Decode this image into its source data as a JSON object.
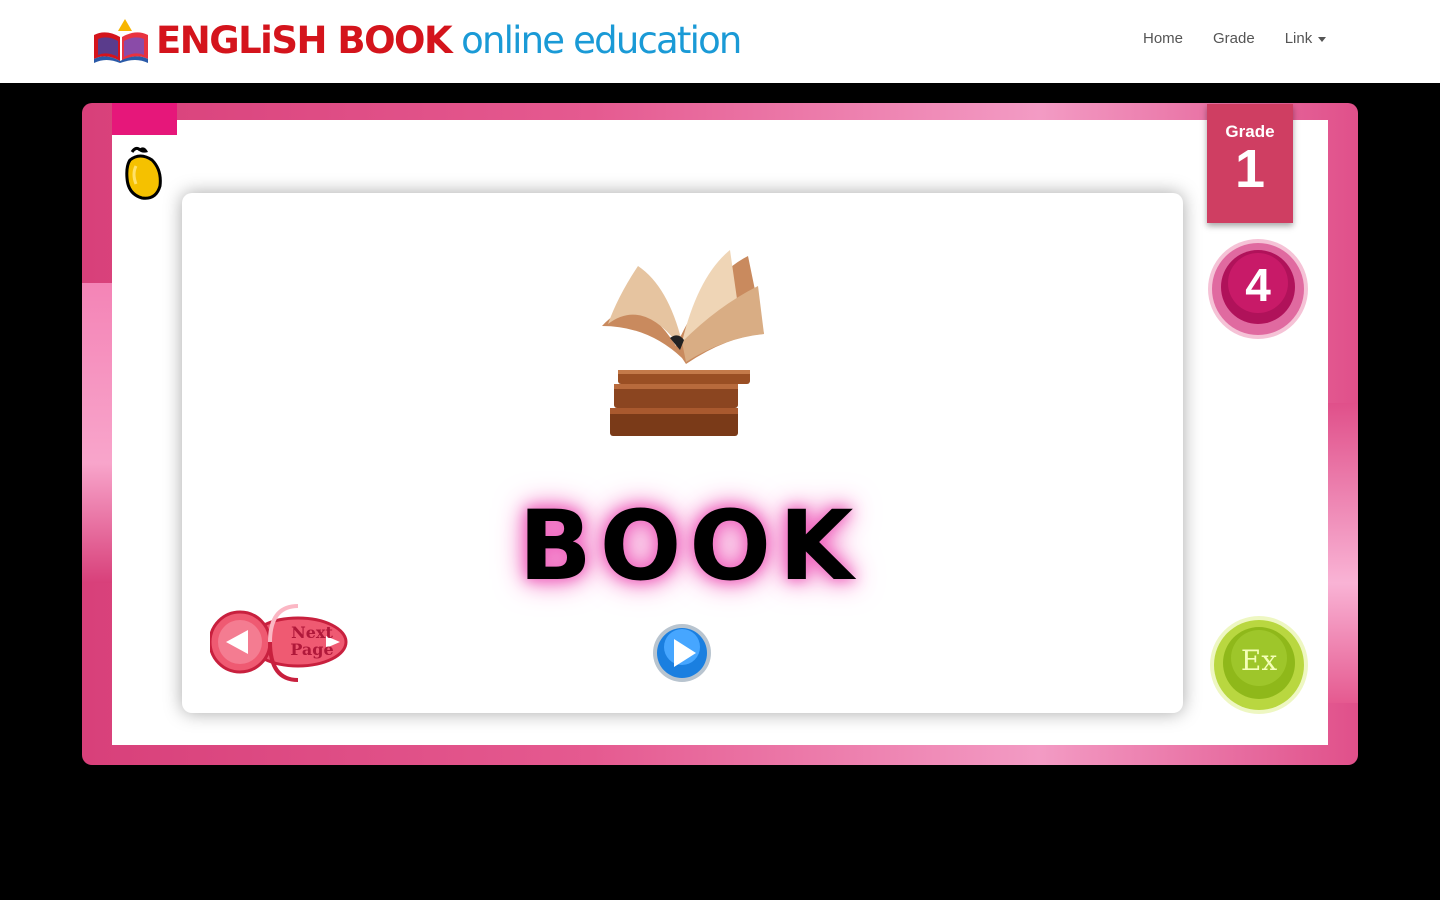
{
  "brand": {
    "name": "ENGLiSH BOOK",
    "tagline": "online education"
  },
  "nav": {
    "home": "Home",
    "grade": "Grade",
    "link": "Link"
  },
  "lesson": {
    "word": "BOOK",
    "grade_label": "Grade",
    "grade_number": "1",
    "unit_number": "4"
  },
  "buttons": {
    "next_page": "Next Page",
    "exercise": "Ex"
  },
  "colors": {
    "frame_pink": "#e55a90",
    "grade_badge": "#cf3e62",
    "brand_red": "#d4141c",
    "brand_blue": "#1a9ad6",
    "word_glow": "#f06ac0"
  }
}
